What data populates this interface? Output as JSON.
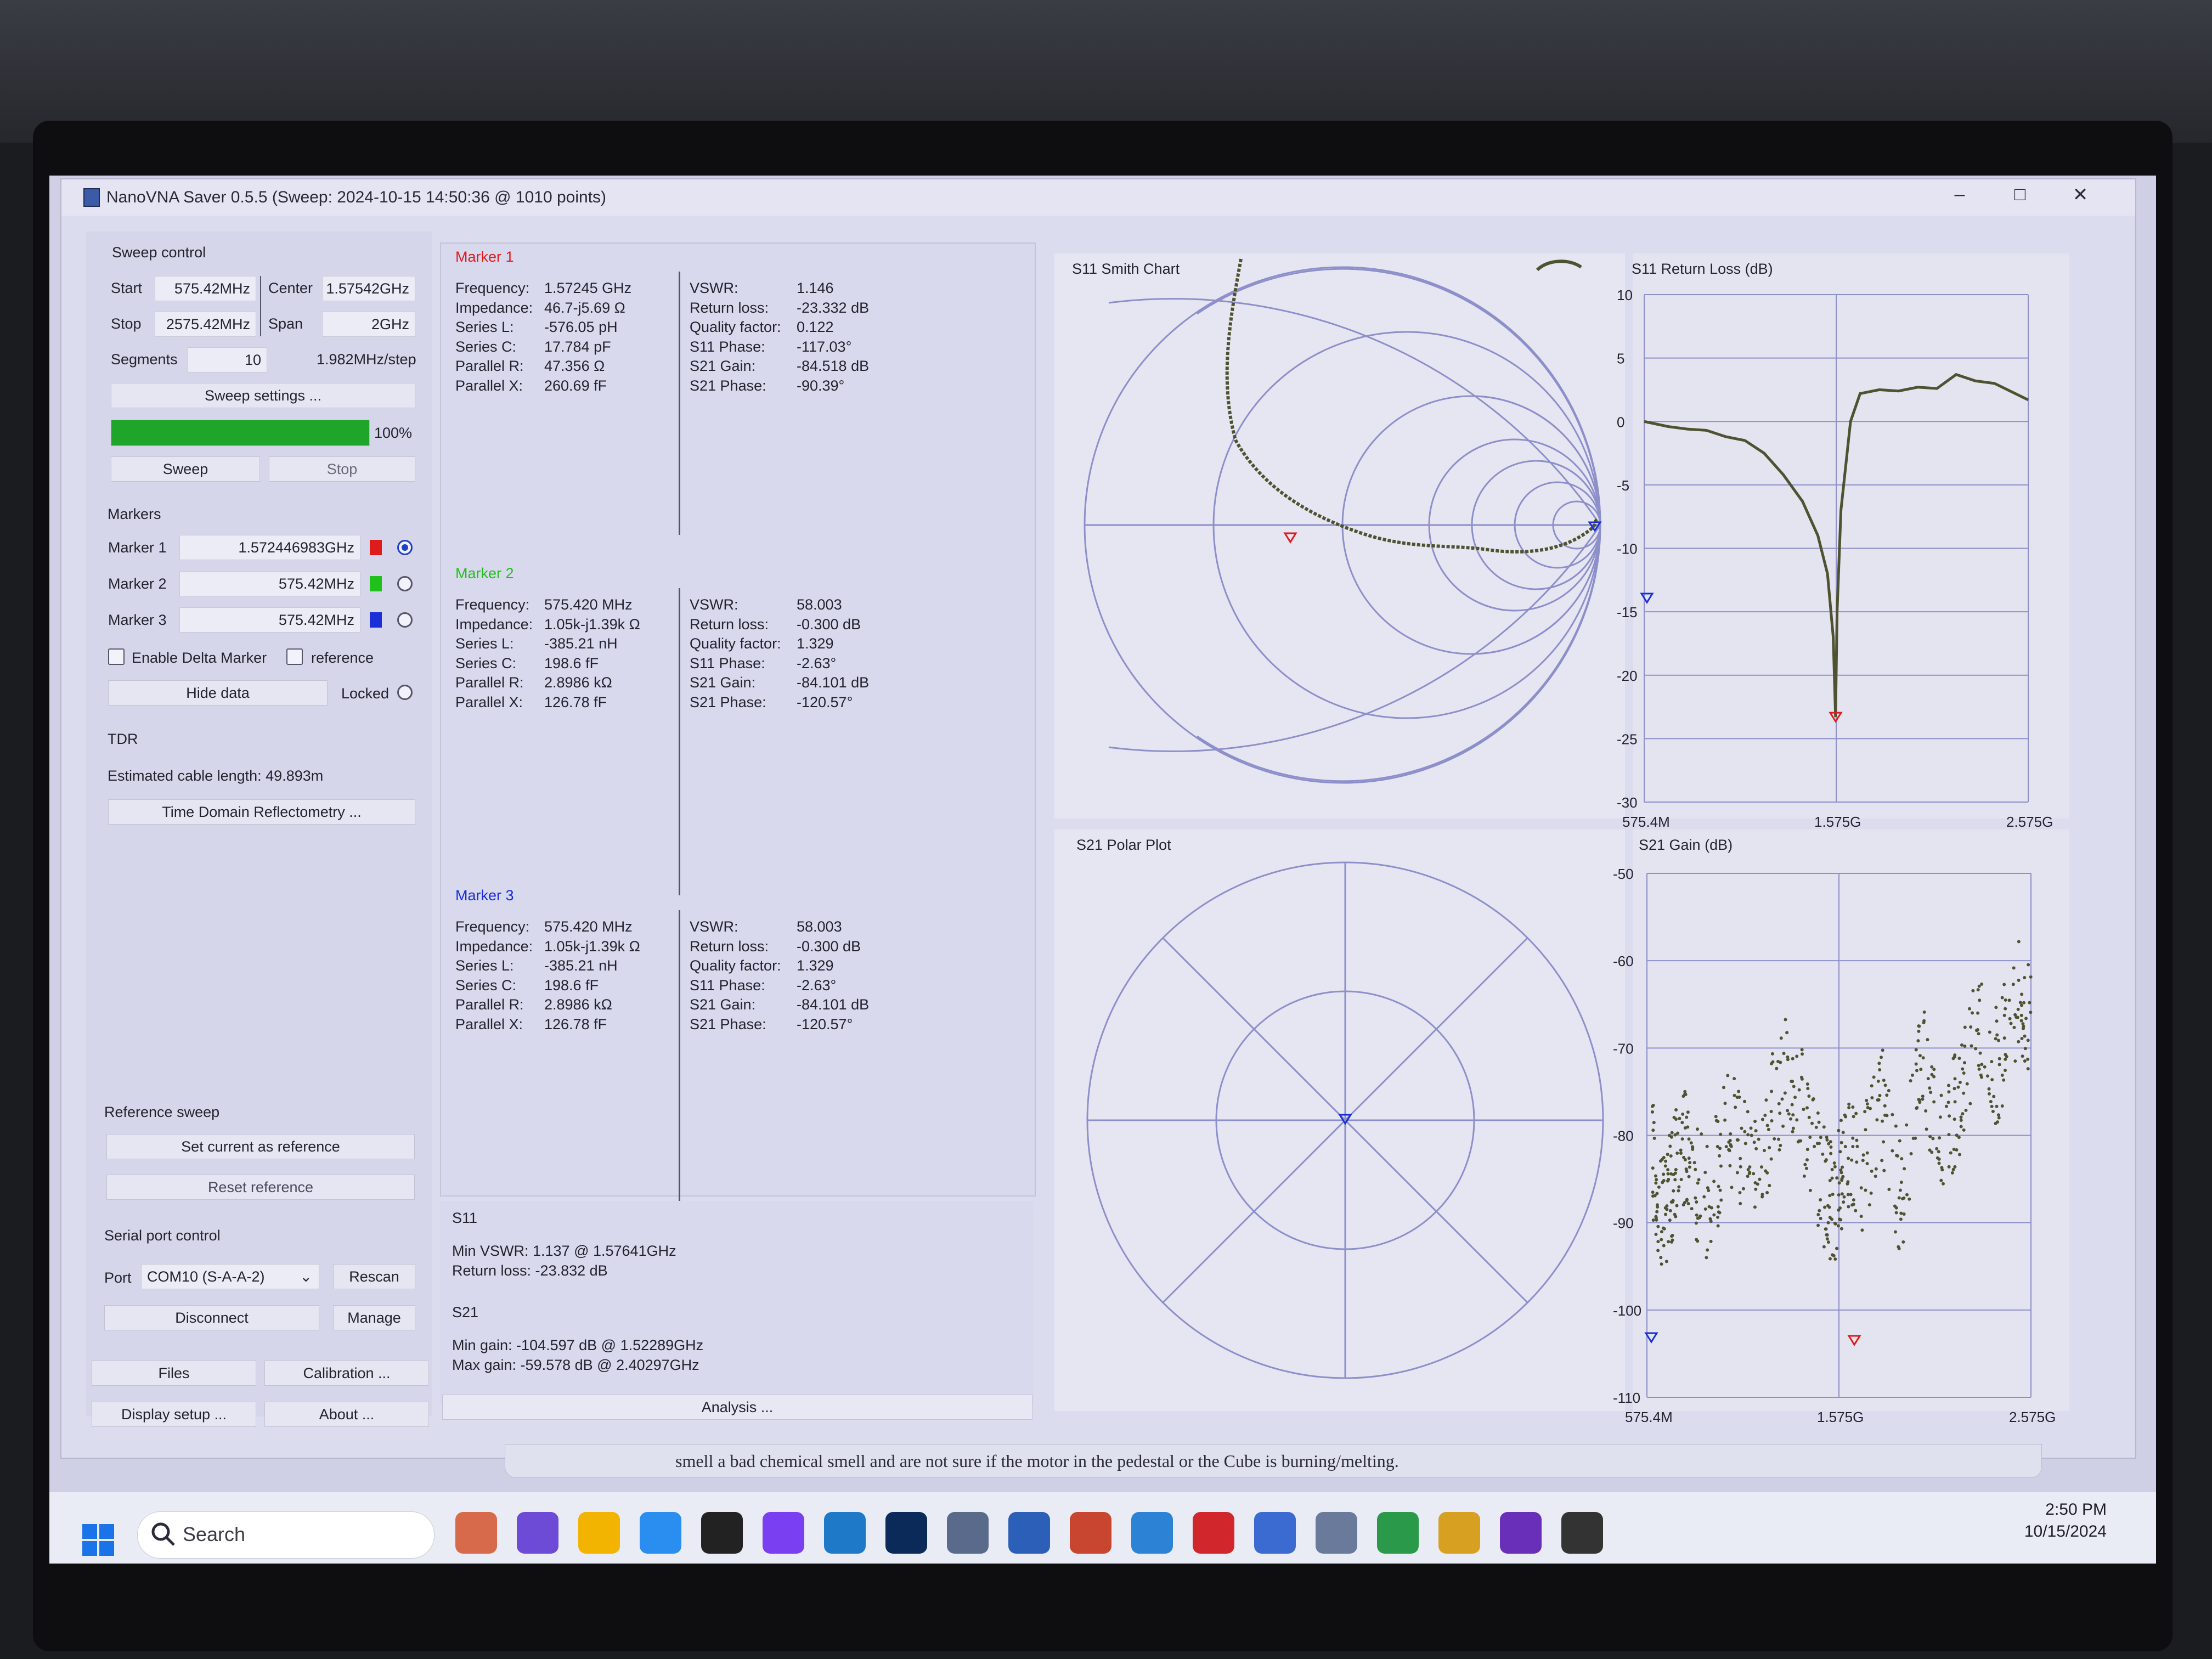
{
  "window": {
    "title": "NanoVNA Saver 0.5.5 (Sweep: 2024-10-15 14:50:36 @ 1010 points)",
    "minimize": "–",
    "maximize": "□",
    "close": "✕"
  },
  "sweep_control": {
    "title": "Sweep control",
    "start_label": "Start",
    "start_value": "575.42MHz",
    "center_label": "Center",
    "center_value": "1.57542GHz",
    "stop_label": "Stop",
    "stop_value": "2575.42MHz",
    "span_label": "Span",
    "span_value": "2GHz",
    "segments_label": "Segments",
    "segments_value": "10",
    "step": "1.982MHz/step",
    "settings_button": "Sweep settings ...",
    "progress_pct": 100,
    "progress_text": "100%",
    "sweep_button": "Sweep",
    "stop_button": "Stop"
  },
  "markers": {
    "title": "Markers",
    "items": [
      {
        "label": "Marker 1",
        "value": "1.572446983GHz",
        "color": "#e01b1b",
        "selected": true
      },
      {
        "label": "Marker 2",
        "value": "575.42MHz",
        "color": "#22c01c",
        "selected": false
      },
      {
        "label": "Marker 3",
        "value": "575.42MHz",
        "color": "#1a2fd8",
        "selected": false
      }
    ],
    "enable_delta": "Enable Delta Marker",
    "reference": "reference",
    "hide_data": "Hide data",
    "locked": "Locked"
  },
  "tdr": {
    "title": "TDR",
    "estimate": "Estimated cable length: 49.893m",
    "button": "Time Domain Reflectometry ..."
  },
  "reference_sweep": {
    "title": "Reference sweep",
    "set_button": "Set current as reference",
    "reset_button": "Reset reference"
  },
  "serial": {
    "title": "Serial port control",
    "port_label": "Port",
    "port_value": "COM10 (S-A-A-2)",
    "rescan": "Rescan",
    "disconnect": "Disconnect",
    "manage": "Manage"
  },
  "bottom_buttons": {
    "files": "Files",
    "calibration": "Calibration ...",
    "display": "Display setup ...",
    "about": "About ..."
  },
  "marker_panels": [
    {
      "title": "Marker 1",
      "color": "#e01b1b",
      "left": [
        "Frequency:",
        "Impedance:",
        "Series L:",
        "Series C:",
        "Parallel R:",
        "Parallel X:"
      ],
      "left_vals": [
        "1.57245 GHz",
        "46.7-j5.69 Ω",
        "-576.05 pH",
        "17.784 pF",
        "47.356 Ω",
        "260.69 fF"
      ],
      "right": [
        "VSWR:",
        "Return loss:",
        "Quality factor:",
        "S11 Phase:",
        "S21 Gain:",
        "S21 Phase:"
      ],
      "right_vals": [
        "1.146",
        "-23.332 dB",
        "0.122",
        "-117.03°",
        "-84.518 dB",
        "-90.39°"
      ]
    },
    {
      "title": "Marker 2",
      "color": "#22c01c",
      "left": [
        "Frequency:",
        "Impedance:",
        "Series L:",
        "Series C:",
        "Parallel R:",
        "Parallel X:"
      ],
      "left_vals": [
        "575.420 MHz",
        "1.05k-j1.39k Ω",
        "-385.21 nH",
        "198.6 fF",
        "2.8986 kΩ",
        "126.78 fF"
      ],
      "right": [
        "VSWR:",
        "Return loss:",
        "Quality factor:",
        "S11 Phase:",
        "S21 Gain:",
        "S21 Phase:"
      ],
      "right_vals": [
        "58.003",
        "-0.300 dB",
        "1.329",
        "-2.63°",
        "-84.101 dB",
        "-120.57°"
      ]
    },
    {
      "title": "Marker 3",
      "color": "#1a2fd8",
      "left": [
        "Frequency:",
        "Impedance:",
        "Series L:",
        "Series C:",
        "Parallel R:",
        "Parallel X:"
      ],
      "left_vals": [
        "575.420 MHz",
        "1.05k-j1.39k Ω",
        "-385.21 nH",
        "198.6 fF",
        "2.8986 kΩ",
        "126.78 fF"
      ],
      "right": [
        "VSWR:",
        "Return loss:",
        "Quality factor:",
        "S11 Phase:",
        "S21 Gain:",
        "S21 Phase:"
      ],
      "right_vals": [
        "58.003",
        "-0.300 dB",
        "1.329",
        "-2.63°",
        "-84.101 dB",
        "-120.57°"
      ]
    }
  ],
  "summary": {
    "s11_title": "S11",
    "s11_vswr": "Min VSWR:   1.137 @ 1.57641GHz",
    "s11_rl": "Return loss:  -23.832 dB",
    "s21_title": "S21",
    "s21_min": "Min gain:   -104.597 dB @ 1.52289GHz",
    "s21_max": "Max gain:   -59.578 dB @ 2.40297GHz",
    "analysis_button": "Analysis ..."
  },
  "charts": {
    "smith_title": "S11 Smith Chart",
    "polar_title": "S21 Polar Plot",
    "rl": {
      "title": "S11 Return Loss (dB)",
      "yticks": [
        "10",
        "5",
        "0",
        "-5",
        "-10",
        "-15",
        "-20",
        "-25",
        "-30"
      ],
      "xticks": [
        "575.4M",
        "1.575G",
        "2.575G"
      ]
    },
    "gain": {
      "title": "S21 Gain (dB)",
      "yticks": [
        "-50",
        "-60",
        "-70",
        "-80",
        "-90",
        "-100",
        "-110"
      ],
      "xticks": [
        "575.4M",
        "1.575G",
        "2.575G"
      ]
    }
  },
  "chart_data": [
    {
      "type": "line",
      "title": "S11 Return Loss (dB)",
      "ylim": [
        -30,
        10
      ],
      "xlim": [
        575.4,
        2575.4
      ],
      "x": [
        575.4,
        700,
        800,
        900,
        1000,
        1100,
        1200,
        1300,
        1400,
        1480,
        1530,
        1560,
        1572,
        1580,
        1600,
        1650,
        1700,
        1800,
        1900,
        2000,
        2100,
        2200,
        2300,
        2400,
        2575.4
      ],
      "series": [
        {
          "values": [
            0,
            -0.4,
            -0.6,
            -0.7,
            -1.2,
            -1.5,
            -2.5,
            -4.2,
            -6.3,
            -9,
            -12,
            -17,
            -23.3,
            -15,
            -7,
            0,
            2.2,
            2.5,
            2.4,
            2.7,
            2.6,
            3.7,
            3.2,
            3.0,
            1.7
          ]
        }
      ]
    },
    {
      "type": "scatter",
      "title": "S21 Gain (dB)",
      "ylim": [
        -110,
        -50
      ],
      "xlim": [
        575.4,
        2575.4
      ],
      "x": [
        600,
        650,
        700,
        750,
        800,
        900,
        1000,
        1100,
        1200,
        1300,
        1400,
        1500,
        1550,
        1600,
        1700,
        1800,
        1900,
        2000,
        2100,
        2200,
        2300,
        2400,
        2500,
        2575
      ],
      "series": [
        {
          "values": [
            -82,
            -90,
            -86,
            -80,
            -84,
            -88,
            -78,
            -84,
            -80,
            -72,
            -78,
            -86,
            -88,
            -83,
            -84,
            -76,
            -88,
            -70,
            -80,
            -76,
            -68,
            -72,
            -64,
            -68
          ]
        }
      ]
    }
  ],
  "taskbar": {
    "search": "Search",
    "time": "2:50 PM",
    "date": "10/15/2024"
  },
  "notice": "smell a bad chemical smell and are not sure if the motor in the pedestal or the Cube is burning/melting."
}
